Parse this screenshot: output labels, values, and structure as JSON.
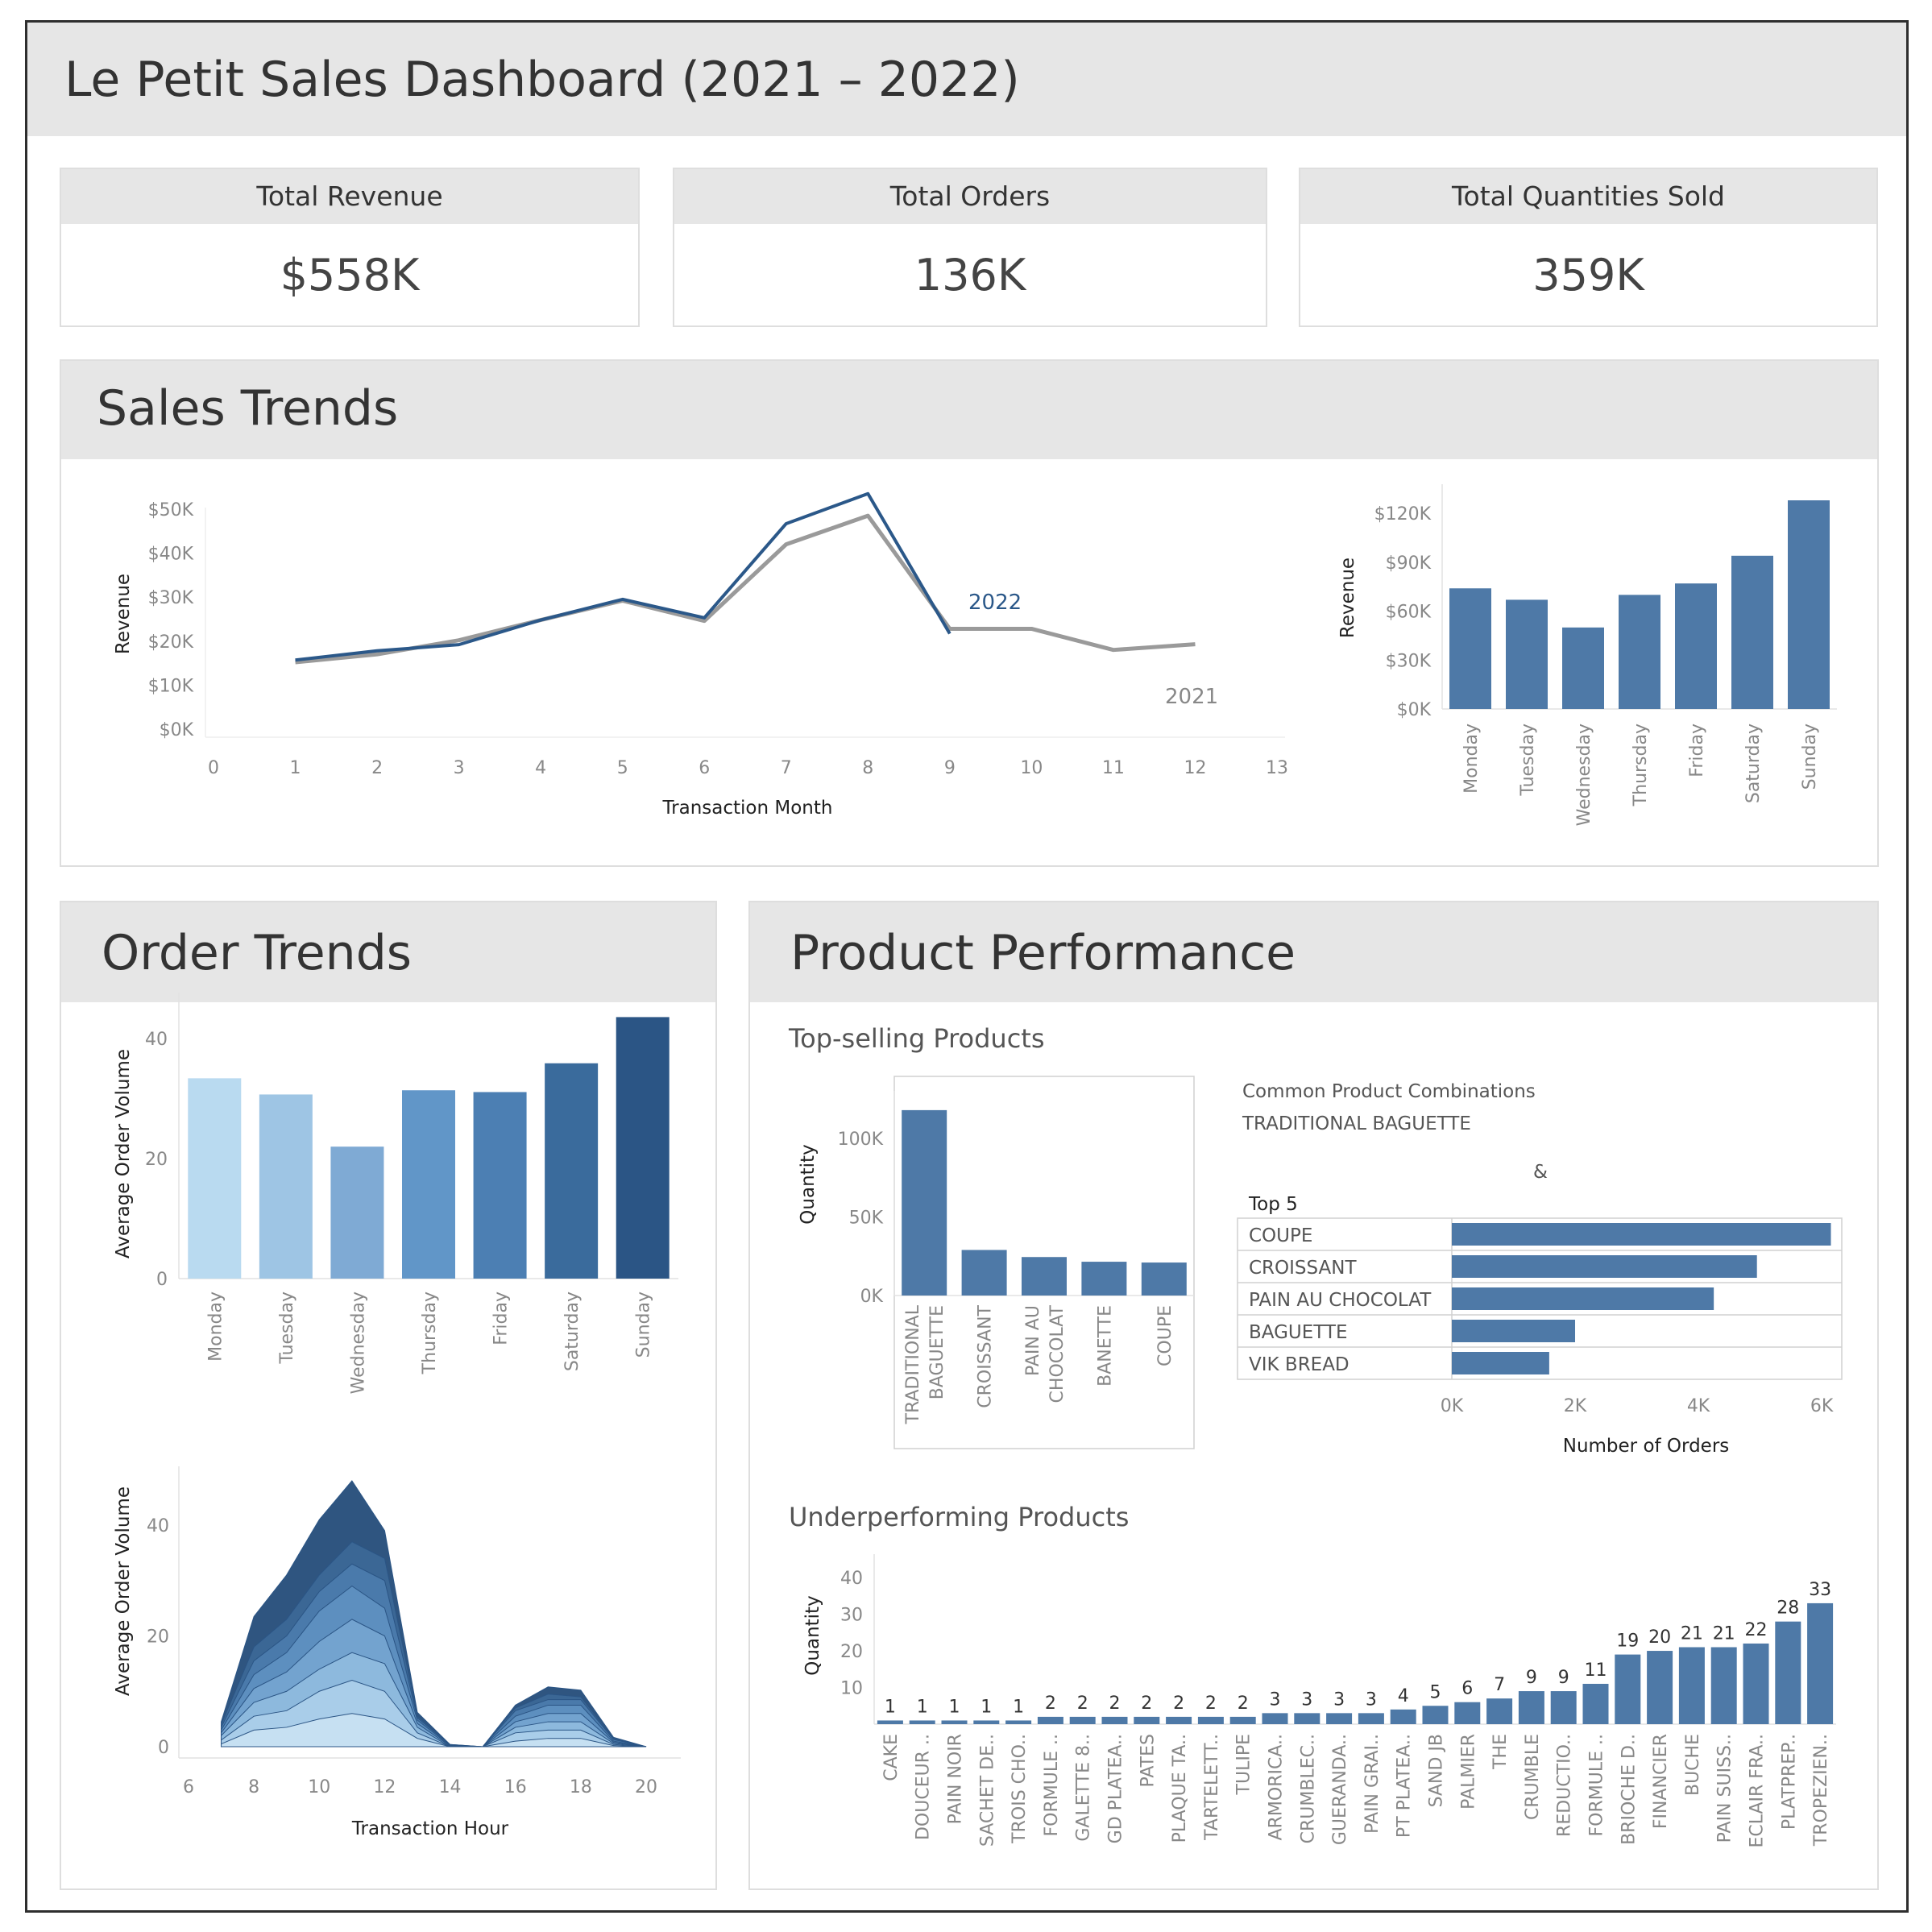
{
  "title": "Le Petit Sales Dashboard (2021 – 2022)",
  "kpis": [
    {
      "label": "Total Revenue",
      "value": "$558K"
    },
    {
      "label": "Total Orders",
      "value": "136K"
    },
    {
      "label": "Total Quantities Sold",
      "value": "359K"
    }
  ],
  "sections": {
    "sales_trends": "Sales Trends",
    "order_trends": "Order Trends",
    "product_performance": "Product Performance",
    "top_selling": "Top-selling Products",
    "underperforming": "Underperforming Products"
  },
  "colors": {
    "bar": "#4e79a7",
    "line_2022": "#2b5889",
    "line_2021": "#9a9a9a",
    "blues": [
      "#b9daf0",
      "#9ec5e4",
      "#7faad4",
      "#6196c8",
      "#4c7fb3",
      "#3a6b9c",
      "#2b5585"
    ]
  },
  "chart_data": [
    {
      "type": "line",
      "id": "revenue_by_month",
      "xlabel": "Transaction Month",
      "ylabel": "Revenue",
      "xticks": [
        "0",
        "1",
        "2",
        "3",
        "4",
        "5",
        "6",
        "7",
        "8",
        "9",
        "10",
        "11",
        "12",
        "13"
      ],
      "yticks": [
        "$0K",
        "$10K",
        "$20K",
        "$30K",
        "$40K",
        "$50K"
      ],
      "xlim": [
        0,
        13
      ],
      "ylim": [
        0,
        52000
      ],
      "series": [
        {
          "name": "2022",
          "x": [
            1,
            2,
            3,
            4,
            5,
            6,
            7,
            8,
            9
          ],
          "values": [
            15700,
            17800,
            19200,
            24800,
            29500,
            25300,
            46700,
            53500,
            21700
          ]
        },
        {
          "name": "2021",
          "x": [
            1,
            2,
            3,
            4,
            5,
            6,
            7,
            8,
            9,
            10,
            11,
            12
          ],
          "values": [
            15200,
            17000,
            20200,
            24800,
            29200,
            24600,
            42000,
            48500,
            22800,
            22800,
            18000,
            19300
          ]
        }
      ]
    },
    {
      "type": "bar",
      "id": "revenue_by_weekday",
      "ylabel": "Revenue",
      "categories": [
        "Monday",
        "Tuesday",
        "Wednesday",
        "Thursday",
        "Friday",
        "Saturday",
        "Sunday"
      ],
      "values": [
        74000,
        67000,
        50000,
        70000,
        77000,
        94000,
        128000
      ],
      "yticks": [
        "$0K",
        "$30K",
        "$60K",
        "$90K",
        "$120K"
      ],
      "ylim": [
        0,
        128000
      ]
    },
    {
      "type": "bar",
      "id": "avg_order_volume_by_weekday",
      "ylabel": "Average Order Volume",
      "categories": [
        "Monday",
        "Tuesday",
        "Wednesday",
        "Thursday",
        "Friday",
        "Saturday",
        "Sunday"
      ],
      "values": [
        33.4,
        30.7,
        22.0,
        31.4,
        31.1,
        35.9,
        43.6
      ],
      "yticks": [
        "0",
        "20",
        "40"
      ],
      "ylim": [
        0,
        45
      ]
    },
    {
      "type": "area",
      "id": "avg_order_volume_by_hour",
      "xlabel": "Transaction Hour",
      "ylabel": "Average Order Volume",
      "xticks": [
        "6",
        "8",
        "10",
        "12",
        "14",
        "16",
        "18",
        "20"
      ],
      "yticks": [
        "0",
        "20",
        "40"
      ],
      "xlim": [
        5.5,
        21
      ],
      "ylim": [
        -1.5,
        49
      ],
      "x": [
        7,
        8,
        9,
        10,
        11,
        12,
        13,
        14,
        15,
        16,
        17,
        18,
        19,
        20
      ],
      "series": [
        {
          "name": "layer 1",
          "values": [
            0.5,
            3,
            3.5,
            5,
            6,
            5,
            1.5,
            0,
            0,
            1,
            1.5,
            1.5,
            0.2,
            0
          ]
        },
        {
          "name": "layer 2",
          "values": [
            1.2,
            5.5,
            6.5,
            10,
            12,
            10,
            2.5,
            0,
            0,
            2.5,
            3,
            3,
            0.4,
            0
          ]
        },
        {
          "name": "layer 3",
          "values": [
            2,
            8,
            10,
            14,
            17,
            15,
            3.5,
            0,
            0,
            3.5,
            4.5,
            4.5,
            0.6,
            0
          ]
        },
        {
          "name": "layer 4",
          "values": [
            2.5,
            10.5,
            13.5,
            19,
            23,
            20,
            4.2,
            0.1,
            0,
            4.5,
            6,
            6,
            0.8,
            0
          ]
        },
        {
          "name": "layer 5",
          "values": [
            3,
            13,
            17,
            24.5,
            29,
            25,
            4.8,
            0.2,
            0,
            5.5,
            7.5,
            7.5,
            1,
            0
          ]
        },
        {
          "name": "layer 6",
          "values": [
            3.5,
            15.5,
            20,
            28,
            33,
            30,
            5.2,
            0.3,
            0,
            6.5,
            8.5,
            8.5,
            1.3,
            0
          ]
        },
        {
          "name": "layer 7",
          "values": [
            4,
            18,
            23,
            31,
            37,
            34,
            5.5,
            0.4,
            0,
            7,
            9.5,
            9,
            1.5,
            0
          ]
        },
        {
          "name": "layer 8",
          "values": [
            4.5,
            23.5,
            31,
            41,
            48,
            39,
            6.2,
            0.4,
            0,
            7.5,
            10.8,
            10.2,
            1.7,
            0
          ]
        }
      ]
    },
    {
      "type": "bar",
      "id": "top_selling_products",
      "ylabel": "Quantity",
      "categories": [
        [
          "TRADITIONAL",
          "BAGUETTE"
        ],
        [
          "CROISSANT"
        ],
        [
          "PAIN AU",
          "CHOCOLAT"
        ],
        [
          "BANETTE"
        ],
        [
          "COUPE"
        ]
      ],
      "values": [
        118000,
        29000,
        24500,
        21500,
        21000
      ],
      "yticks": [
        "0K",
        "50K",
        "100K"
      ],
      "ylim": [
        0,
        120000
      ]
    },
    {
      "type": "bar",
      "id": "common_product_combinations",
      "title": "Common Product Combinations",
      "subtitle": "TRADITIONAL BAGUETTE",
      "amp": "&",
      "header": "Top 5",
      "xlabel": "Number of Orders",
      "categories": [
        "COUPE",
        "CROISSANT",
        "PAIN AU CHOCOLAT",
        "BAGUETTE",
        "VIK BREAD"
      ],
      "values": [
        6150,
        4950,
        4250,
        2000,
        1580
      ],
      "xticks": [
        "0K",
        "2K",
        "4K",
        "6K"
      ],
      "xlim": [
        0,
        6300
      ]
    },
    {
      "type": "bar",
      "id": "underperforming_products",
      "ylabel": "Quantity",
      "categories": [
        "CAKE",
        "DOUCEUR ..",
        "PAIN NOIR",
        "SACHET DE..",
        "TROIS CHO..",
        "FORMULE ..",
        "GALETTE 8..",
        "GD PLATEA..",
        "PATES",
        "PLAQUE TA..",
        "TARTELETT..",
        "TULIPE",
        "ARMORICA..",
        "CRUMBLEC..",
        "GUERANDA..",
        "PAIN GRAI..",
        "PT PLATEA..",
        "SAND JB",
        "PALMIER",
        "THE",
        "CRUMBLE",
        "REDUCTIO..",
        "FORMULE ..",
        "BRIOCHE D..",
        "FINANCIER",
        "BUCHE",
        "PAIN SUISS..",
        "ECLAIR FRA..",
        "PLATPREP..",
        "TROPEZIEN.."
      ],
      "values": [
        1,
        1,
        1,
        1,
        1,
        2,
        2,
        2,
        2,
        2,
        2,
        2,
        3,
        3,
        3,
        3,
        4,
        5,
        6,
        7,
        9,
        9,
        11,
        19,
        20,
        21,
        21,
        22,
        28,
        33
      ],
      "yticks": [
        "10",
        "20",
        "30",
        "40"
      ],
      "ylim": [
        0,
        42
      ]
    }
  ]
}
